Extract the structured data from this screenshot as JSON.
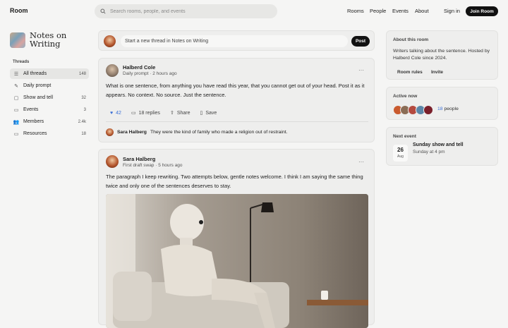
{
  "topbar": {
    "brand": "Room",
    "search_placeholder": "Search rooms, people, and events",
    "nav": [
      "Rooms",
      "People",
      "Events",
      "About"
    ],
    "sign_in": "Sign in",
    "join": "Join Room"
  },
  "sidebar": {
    "room_name_line1": "Notes on",
    "room_name_line2": "Writing",
    "section_label": "Threads",
    "items": [
      {
        "label": "All threads",
        "count": "148",
        "icon": "list-icon"
      },
      {
        "label": "Daily prompt",
        "count": "",
        "icon": "pen-icon"
      },
      {
        "label": "Show and tell",
        "count": "32",
        "icon": "square-icon"
      },
      {
        "label": "Events",
        "count": "3",
        "icon": "calendar-icon"
      },
      {
        "label": "Members",
        "count": "2.4k",
        "icon": "members-icon"
      },
      {
        "label": "Resources",
        "count": "18",
        "icon": "folder-icon"
      }
    ]
  },
  "composer": {
    "placeholder": "Start a new thread in Notes on Writing",
    "post_label": "Post"
  },
  "threads": [
    {
      "author": "Halberd Cole",
      "meta": "Daily prompt · 2 hours ago",
      "body": "What is one sentence, from anything you have read this year, that you cannot get out of your head. Post it as it appears. No context. No source. Just the sentence.",
      "likes": "42",
      "replies": "18 replies",
      "share": "Share",
      "save": "Save",
      "reply_author": "Sara Halberg",
      "reply_text": "They were the kind of family who made a religion out of restraint."
    },
    {
      "author": "Sara Halberg",
      "meta": "First draft swap · 5 hours ago",
      "body": "The paragraph I keep rewriting. Two attempts below, gentle notes welcome. I think I am saying the same thing twice and only one of the sentences deserves to stay."
    }
  ],
  "about": {
    "title": "About this room",
    "body": "Writers talking about the sentence. Hosted by Halberd Cole since 2024.",
    "rules": "Room rules",
    "invite": "Invite"
  },
  "active": {
    "title": "Active now",
    "count": "18",
    "suffix": "people"
  },
  "event": {
    "title": "Next event",
    "day": "26",
    "month": "Aug",
    "name": "Sunday show and tell",
    "time": "Sunday at 4 pm"
  },
  "colors": {
    "accent": "#3b6fd6",
    "dark": "#111111"
  }
}
